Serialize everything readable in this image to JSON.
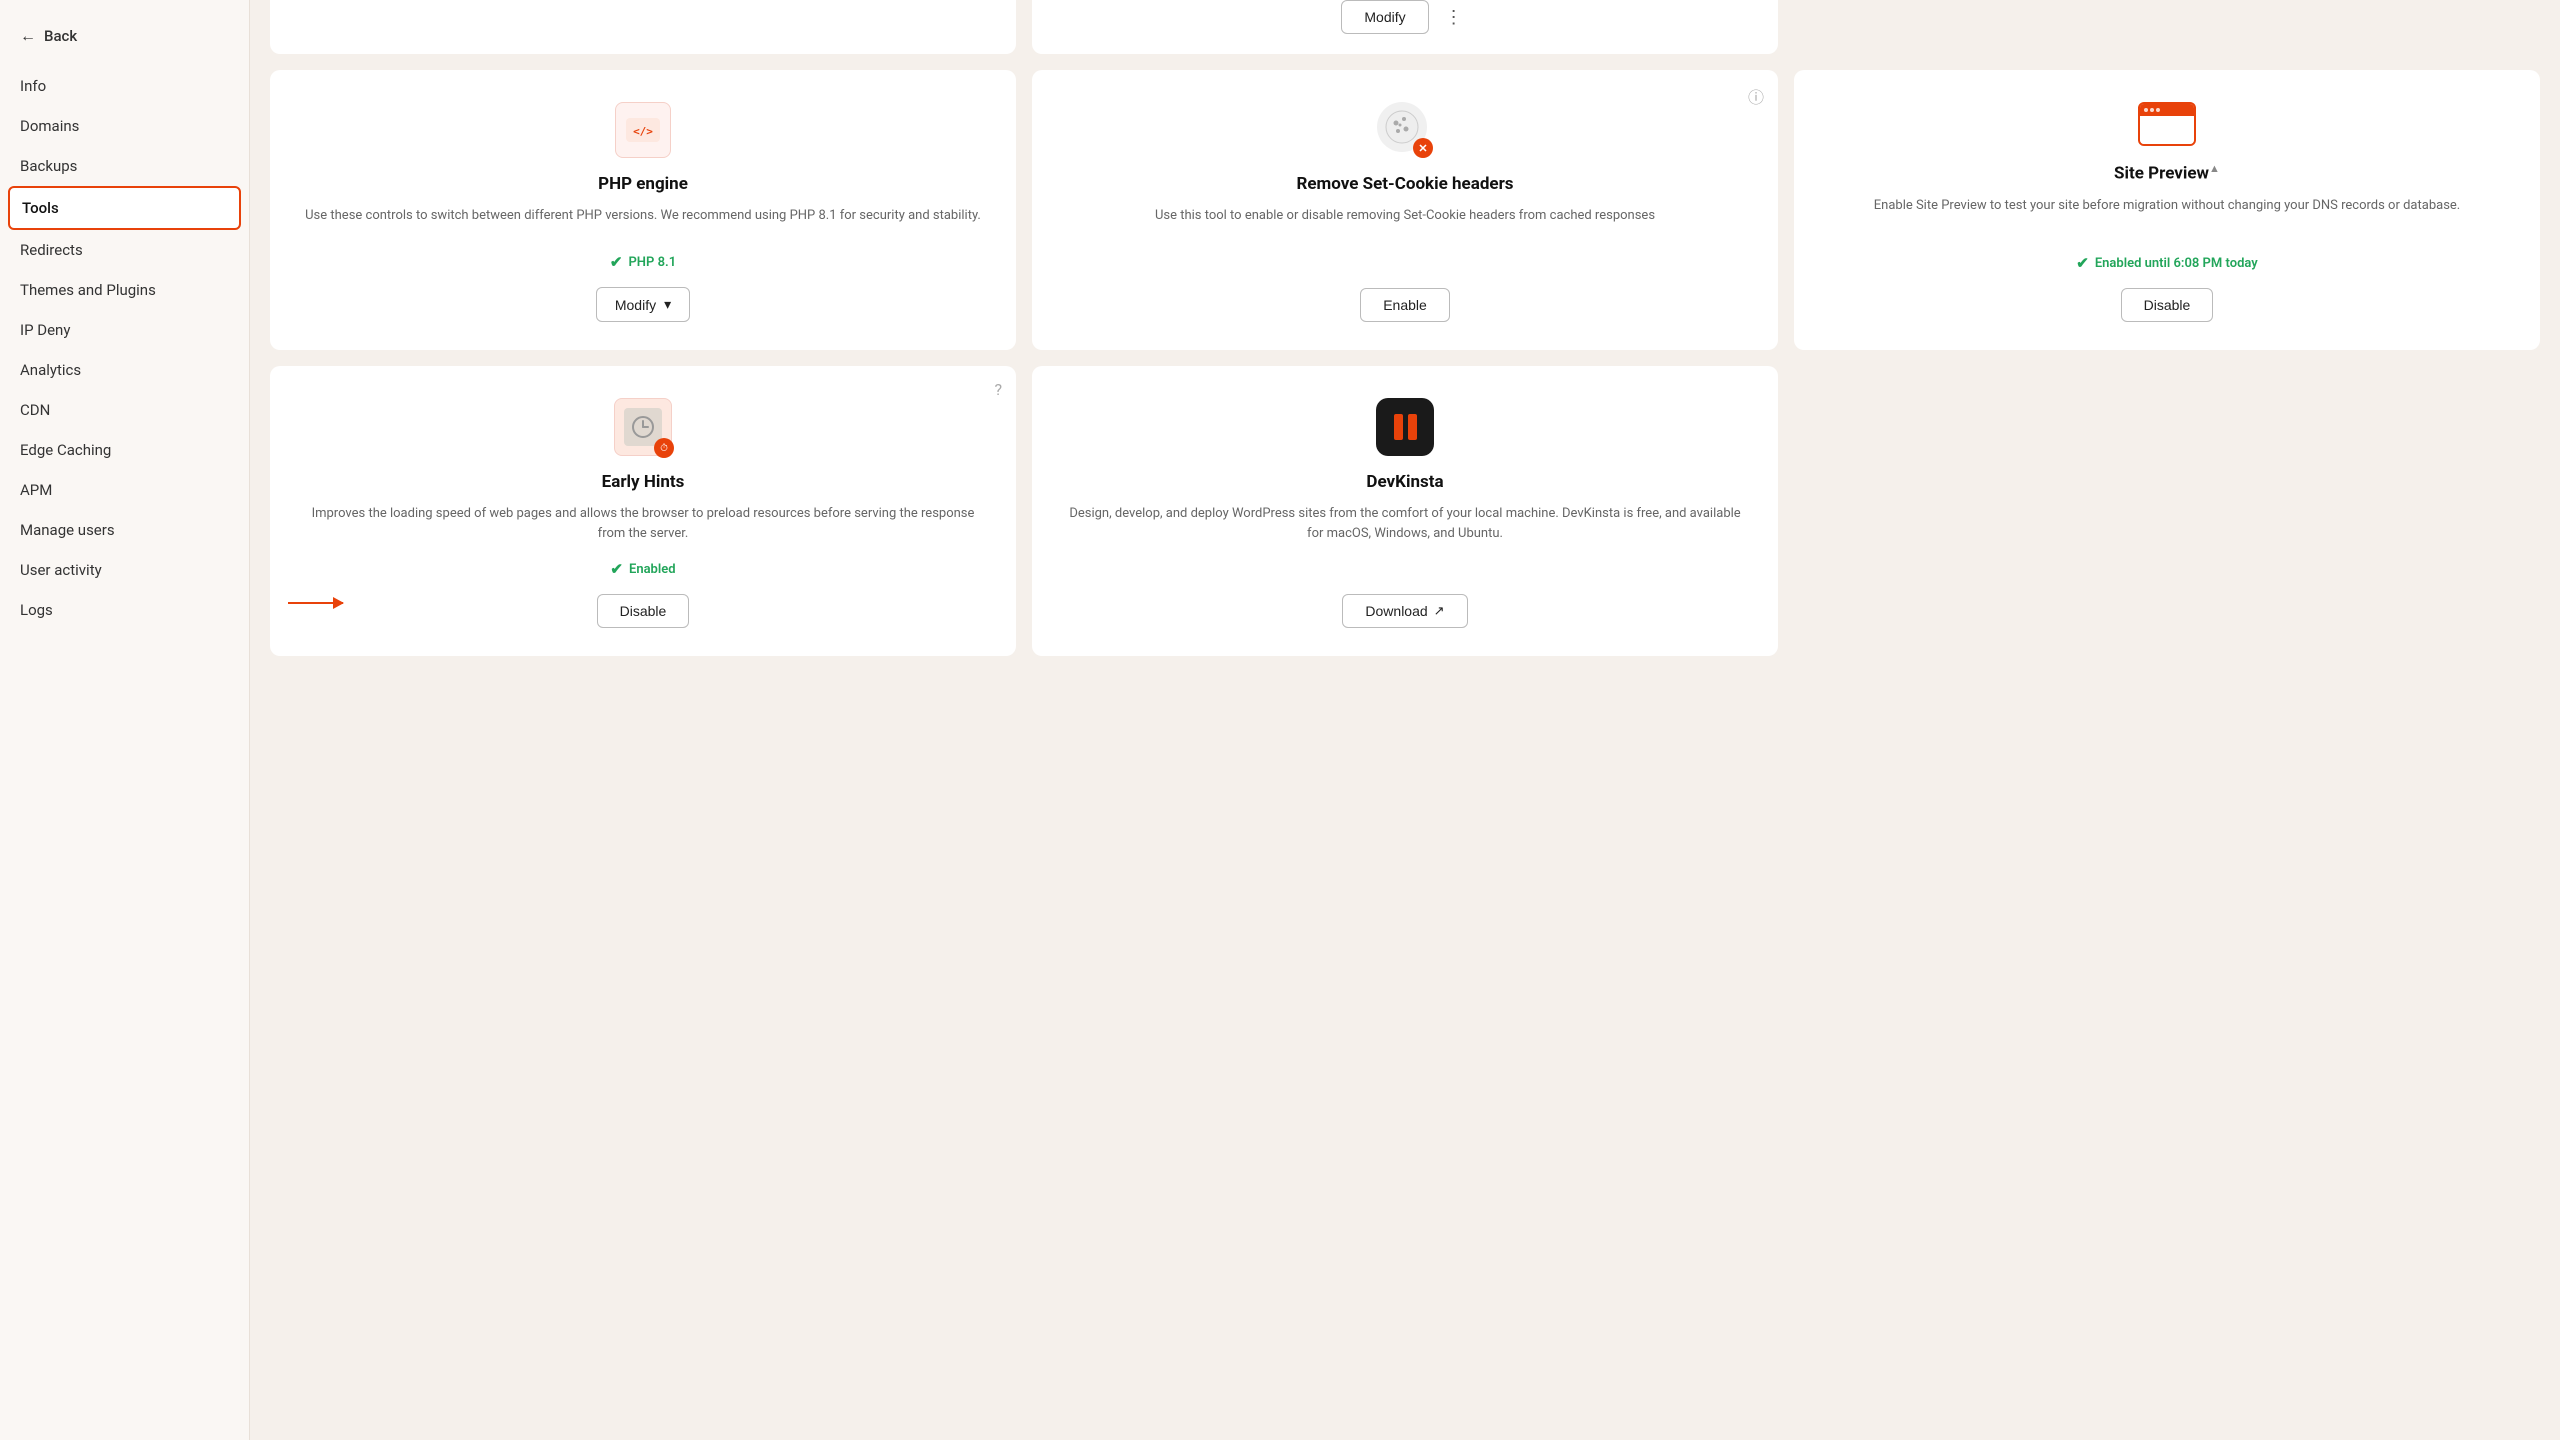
{
  "sidebar": {
    "back_label": "Back",
    "items": [
      {
        "id": "info",
        "label": "Info",
        "active": false
      },
      {
        "id": "domains",
        "label": "Domains",
        "active": false
      },
      {
        "id": "backups",
        "label": "Backups",
        "active": false
      },
      {
        "id": "tools",
        "label": "Tools",
        "active": true
      },
      {
        "id": "redirects",
        "label": "Redirects",
        "active": false
      },
      {
        "id": "themes-plugins",
        "label": "Themes and Plugins",
        "active": false
      },
      {
        "id": "ip-deny",
        "label": "IP Deny",
        "active": false
      },
      {
        "id": "analytics",
        "label": "Analytics",
        "active": false
      },
      {
        "id": "cdn",
        "label": "CDN",
        "active": false
      },
      {
        "id": "edge-caching",
        "label": "Edge Caching",
        "active": false
      },
      {
        "id": "apm",
        "label": "APM",
        "active": false
      },
      {
        "id": "manage-users",
        "label": "Manage users",
        "active": false
      },
      {
        "id": "user-activity",
        "label": "User activity",
        "active": false
      },
      {
        "id": "logs",
        "label": "Logs",
        "active": false
      }
    ]
  },
  "top_row": {
    "modify_label": "Modify",
    "more_icon": "⋮"
  },
  "cards": {
    "php_engine": {
      "title": "PHP engine",
      "desc": "Use these controls to switch between different PHP versions. We recommend using PHP 8.1 for security and stability.",
      "status": "PHP 8.1",
      "modify_label": "Modify",
      "icon_text": "</>"
    },
    "remove_cookie": {
      "title": "Remove Set-Cookie headers",
      "desc": "Use this tool to enable or disable removing Set-Cookie headers from cached responses",
      "enable_label": "Enable",
      "info_icon": "ℹ"
    },
    "site_preview": {
      "title": "Site Preview",
      "desc": "Enable Site Preview to test your site before migration without changing your DNS records or database.",
      "status": "Enabled until 6:08 PM today",
      "disable_label": "Disable",
      "warning": "▲"
    },
    "early_hints": {
      "title": "Early Hints",
      "desc": "Improves the loading speed of web pages and allows the browser to preload resources before serving the response from the server.",
      "status": "Enabled",
      "disable_label": "Disable",
      "info_icon": "?"
    },
    "devkinsta": {
      "title": "DevKinsta",
      "desc": "Design, develop, and deploy WordPress sites from the comfort of your local machine. DevKinsta is free, and available for macOS, Windows, and Ubuntu.",
      "download_label": "Download",
      "external_icon": "↗"
    }
  },
  "colors": {
    "accent": "#e8420a",
    "green": "#22a55a",
    "sidebar_active_border": "#e8420a"
  }
}
